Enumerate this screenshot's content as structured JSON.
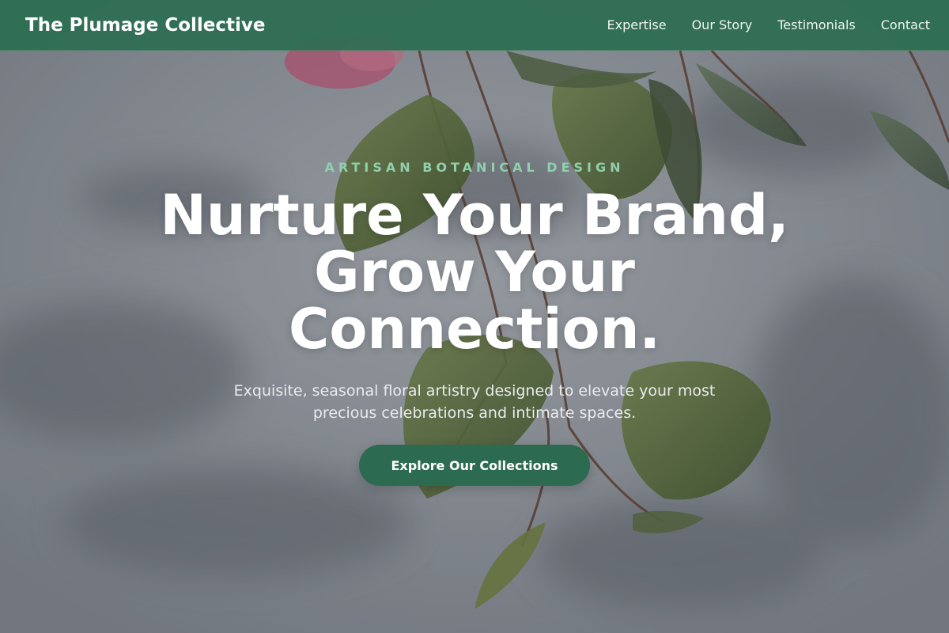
{
  "header": {
    "brand": "The Plumage Collective",
    "nav": [
      {
        "label": "Expertise"
      },
      {
        "label": "Our Story"
      },
      {
        "label": "Testimonials"
      },
      {
        "label": "Contact"
      }
    ]
  },
  "hero": {
    "eyebrow": "ARTISAN BOTANICAL DESIGN",
    "headline": [
      "Nurture Your Brand,",
      "Grow Your",
      "Connection."
    ],
    "subtext": "Exquisite, seasonal floral artistry designed to elevate your most precious celebrations and intimate spaces.",
    "cta_label": "Explore Our Collections"
  },
  "colors": {
    "header_bg": "#2c6e52",
    "accent_green": "#2d6b51",
    "eyebrow_green": "#8fd0ac"
  },
  "icons": {
    "background": "eucalyptus-leaves-photo"
  }
}
